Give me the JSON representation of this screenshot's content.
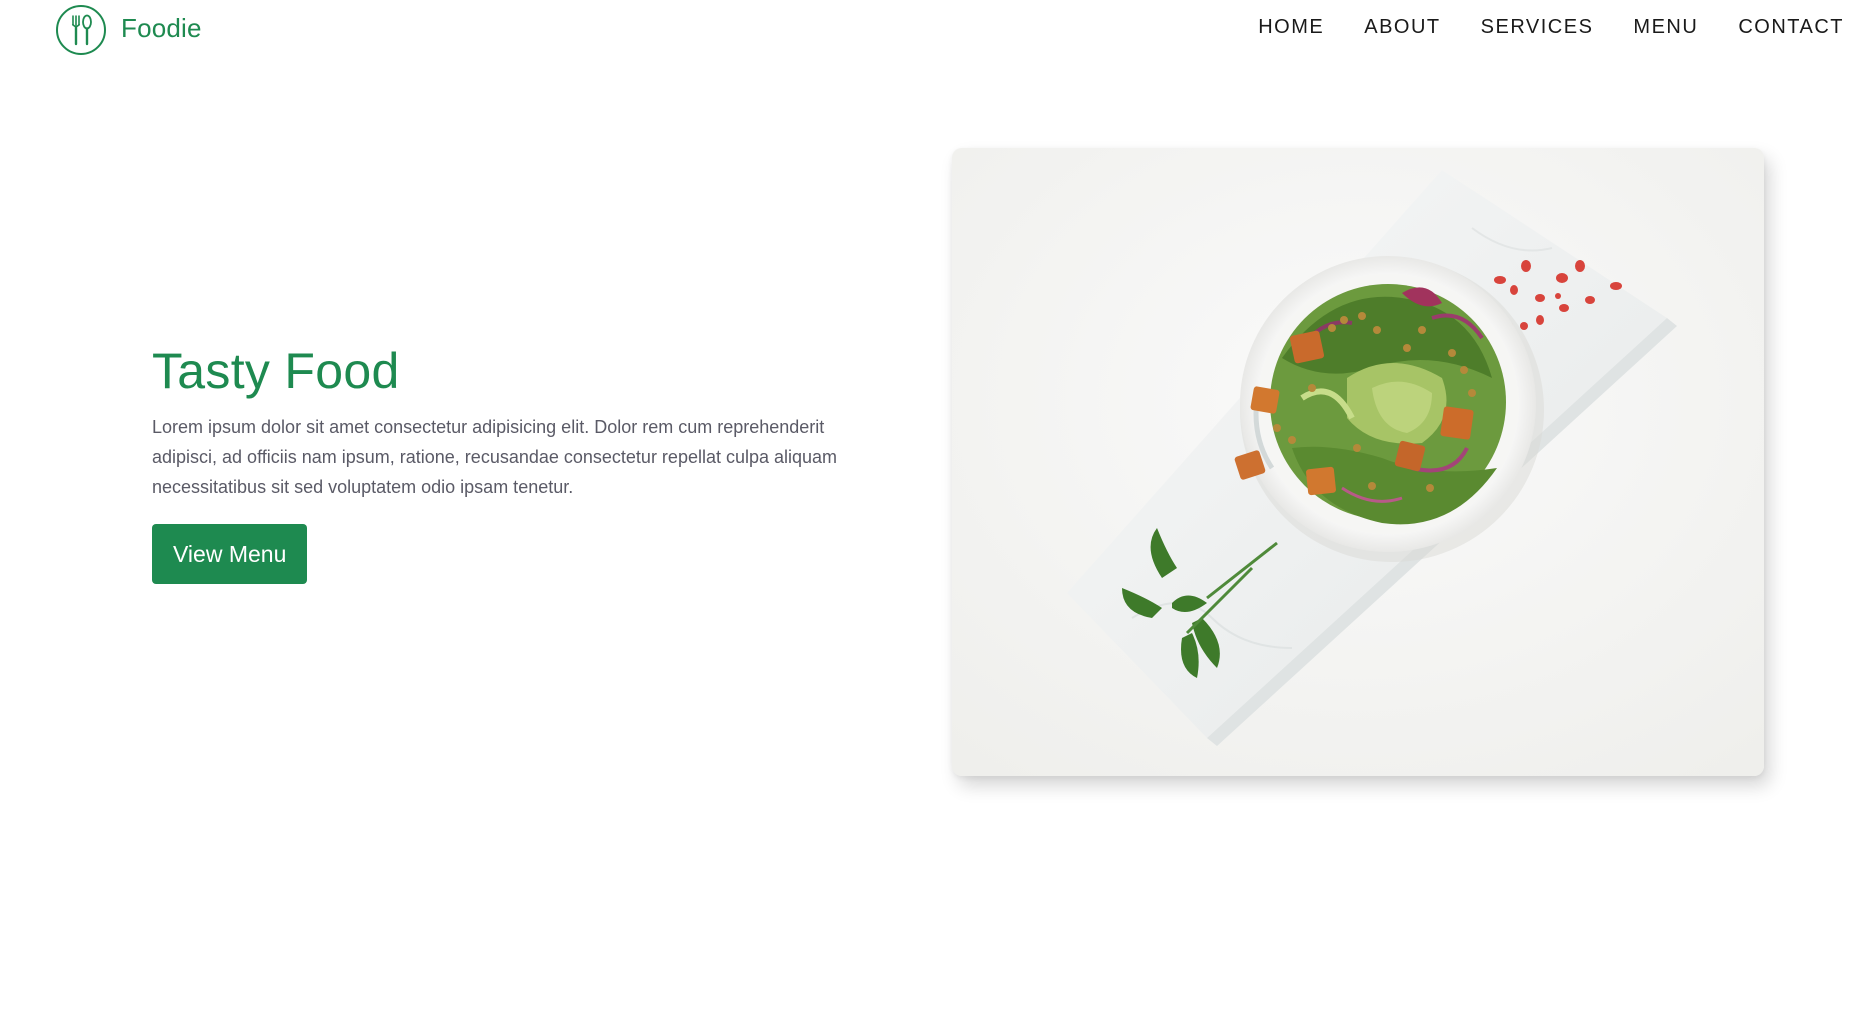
{
  "brand": {
    "name": "Foodie",
    "logo_icon": "fork-spoon-circle-icon",
    "color": "#1e8a50"
  },
  "nav": {
    "items": [
      {
        "label": "HOME"
      },
      {
        "label": "ABOUT"
      },
      {
        "label": "SERVICES"
      },
      {
        "label": "MENU"
      },
      {
        "label": "CONTACT"
      }
    ]
  },
  "hero": {
    "title": "Tasty Food",
    "description": "Lorem ipsum dolor sit amet consectetur adipisicing elit. Dolor rem cum reprehenderit adipisci, ad officiis nam ipsum, ratione, recusandae consectetur repellat culpa aliquam necessitatibus sit sed voluptatem odio ipsam tenetur.",
    "button_label": "View Menu",
    "image_icon": "salad-bowl-photo"
  },
  "colors": {
    "accent": "#1e8a50",
    "body_text": "#5a5a66",
    "nav_text": "#1a1a1a"
  }
}
